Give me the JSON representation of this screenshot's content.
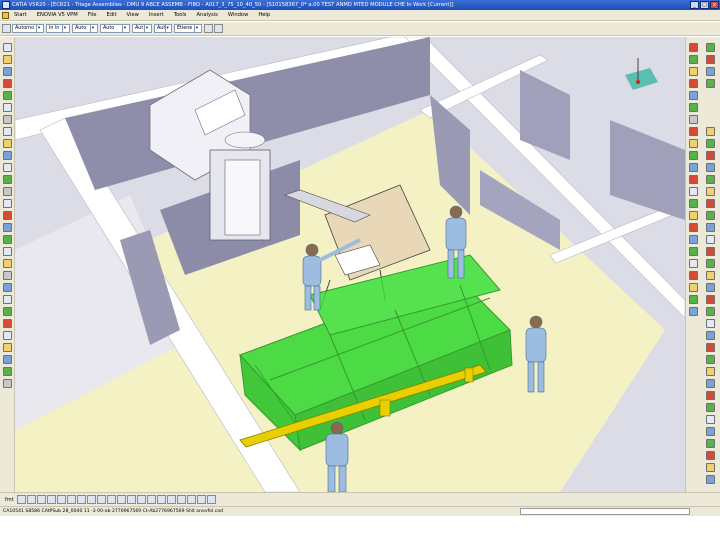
{
  "window": {
    "title": "CATIA V5R20 - [ECR21 - Triage Assemblies - DMU 9 ABCE ASSEMB - FIBO - A017_3_75_10_40_50 - [S10158367_0* a.00 TEST ANMD MTED MODULE CHE In Work [Current]]",
    "min_label": "_",
    "max_label": "□",
    "close_label": "x"
  },
  "menubar": {
    "items": [
      "Start",
      "ENOVIA V5 VPM",
      "File",
      "Edit",
      "View",
      "Insert",
      "Tools",
      "Analysis",
      "Window",
      "Help"
    ]
  },
  "toolbar": {
    "combos": [
      {
        "value": "Autorno",
        "width": 28
      },
      {
        "value": "In ln",
        "width": 22
      },
      {
        "value": "Auto",
        "width": 22
      },
      {
        "value": "Auto",
        "width": 26
      },
      {
        "value": "Aut",
        "width": 16
      },
      {
        "value": "Aut",
        "width": 14
      },
      {
        "value": "Etiene",
        "width": 24
      }
    ]
  },
  "bottom": {
    "label": "fmt"
  },
  "status": {
    "text": "CA10541 S8586 CAtPSub 28_0040 11 -3 00-ob 2776967569 Ct-Ab2776967569 Shit anovfol.cad"
  },
  "colors": {
    "title_bar": "#2552c4",
    "chrome": "#ece9d8",
    "floor": "#f2f0c6",
    "wall_top": "#ffffff",
    "wall_side": "#8c8ca8",
    "green_module": "#22d622",
    "yellow_rail": "#e8d000",
    "mannequin": "#9cbce0"
  }
}
